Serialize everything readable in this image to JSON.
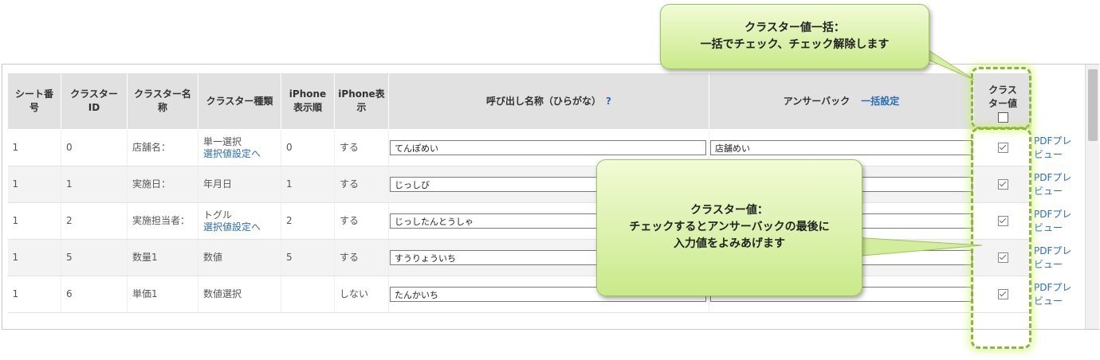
{
  "table": {
    "headers": {
      "sheet_no": "シート番号",
      "cluster_id": "クラスターID",
      "cluster_name": "クラスター名称",
      "cluster_type": "クラスター種類",
      "iphone_order": "iPhone表示順",
      "iphone_show": "iPhone表示",
      "call_name": "呼び出し名称（ひらがな）",
      "call_name_help": "?",
      "answer_back": "アンサーバック",
      "answer_back_link": "一括設定",
      "cluster_value": "クラスター値"
    },
    "rows": [
      {
        "sheet": "1",
        "id": "0",
        "name": "店舗名：",
        "type": "単一選択",
        "type_link": "選択値設定へ",
        "order": "0",
        "show": "する",
        "call": "てんぽめい",
        "answer": "店舗めい",
        "checked": true,
        "pdf": "PDFプレビュー"
      },
      {
        "sheet": "1",
        "id": "1",
        "name": "実施日：",
        "type": "年月日",
        "type_link": "",
        "order": "1",
        "show": "する",
        "call": "じっしび",
        "answer": "",
        "checked": true,
        "pdf": "PDFプレビュー"
      },
      {
        "sheet": "1",
        "id": "2",
        "name": "実施担当者：",
        "type": "トグル",
        "type_link": "選択値設定へ",
        "order": "2",
        "show": "する",
        "call": "じっしたんとうしゃ",
        "answer": "",
        "checked": true,
        "pdf": "PDFプレビュー"
      },
      {
        "sheet": "1",
        "id": "5",
        "name": "数量1",
        "type": "数値",
        "type_link": "",
        "order": "5",
        "show": "する",
        "call": "すうりょういち",
        "answer": "",
        "checked": true,
        "pdf": "PDFプレビュー"
      },
      {
        "sheet": "1",
        "id": "6",
        "name": "単価1",
        "type": "数値選択",
        "type_link": "",
        "order": "",
        "show": "しない",
        "call": "たんかいち",
        "answer": "",
        "checked": true,
        "pdf": "PDFプレビュー"
      }
    ]
  },
  "callouts": {
    "top": {
      "line1": "クラスター値一括：",
      "line2": "一括でチェック、チェック解除します"
    },
    "middle": {
      "line1": "クラスター値：",
      "line2": "チェックするとアンサーバックの最後に",
      "line3": "入力値をよみあげます"
    }
  },
  "colors": {
    "link": "#2a6ebb",
    "header_bg": "#e1e1e1",
    "callout_green": "#c9ea8a",
    "dash_green": "#88bb33"
  }
}
